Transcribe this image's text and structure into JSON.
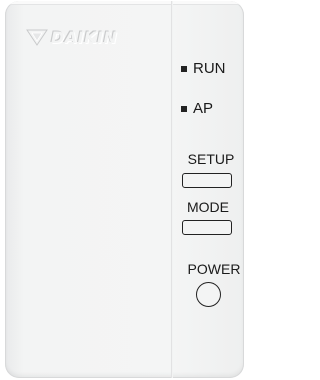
{
  "brand": {
    "logo_text": "DAIKIN",
    "logo_icon": "daikin-triangle-logo"
  },
  "indicators": {
    "run_label": "RUN",
    "ap_label": "AP"
  },
  "buttons": {
    "setup_label": "SETUP",
    "mode_label": "MODE",
    "power_label": "POWER"
  },
  "colors": {
    "body": "#f3f4f4",
    "text": "#1a1a1a",
    "outline": "#222222"
  }
}
